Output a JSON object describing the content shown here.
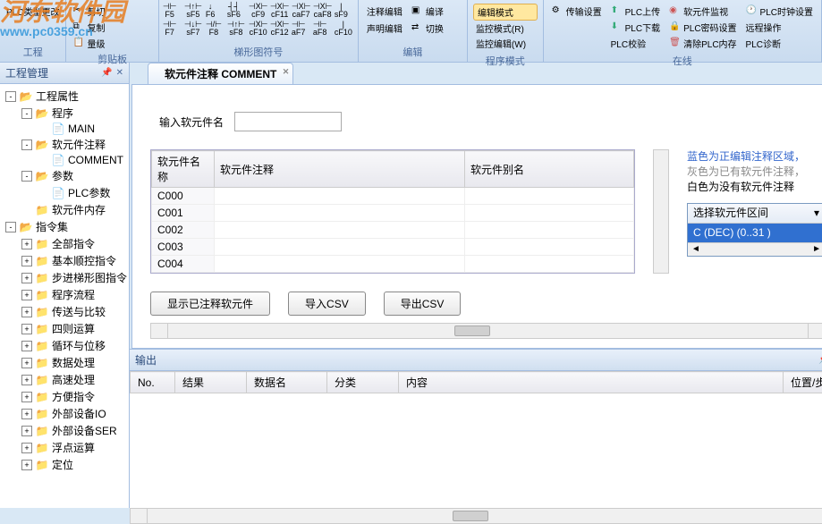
{
  "watermark": {
    "main": "河东软件园",
    "sub": "www.pc0359.cn"
  },
  "ribbon": {
    "groups": {
      "project": {
        "label": "工程",
        "btnType": "PLC类型更改"
      },
      "clipboard": {
        "label": "剪贴板",
        "cut": "剪切",
        "copy": "复制",
        "paste": "量级"
      },
      "ladder": {
        "label": "梯形图符号",
        "cells": [
          [
            "⊣⊢\nF5",
            "⊣↑⊢\nsF5",
            "↓\nF6",
            "┤┤\nsF6",
            "⊣X⊢\ncF9",
            "⊣X⊢\ncF11",
            "⊣X⊢\ncaF7",
            "⊣X⊢\ncaF8",
            "|\nsF9"
          ],
          [
            "⊣⊢\nF7",
            "⊣↓⊢\nsF7",
            "⊣/⊢\nF8",
            "⊣↑⊢\nsF8",
            "⊣X⊢\ncF10",
            "⊣X⊢\ncF12",
            "⊣⊢\naF7",
            "⊣⊢\naF8",
            "|\ncF10"
          ]
        ]
      },
      "edit": {
        "label": "编辑",
        "a1": "注释编辑",
        "a2": "声明编辑",
        "b1": "编译",
        "b2": "切换"
      },
      "program": {
        "label": "程序",
        "a": "编辑模式",
        "b": "监控模式(R)",
        "c": "监控编辑(W)",
        "d": "程序模式"
      },
      "online": {
        "label": "在线",
        "a": "传输设置",
        "b": "PLC上传",
        "c": "PLC下载",
        "d": "PLC校验",
        "e": "软元件监视",
        "f": "PLC密码设置",
        "g": "清除PLC内存",
        "h": "PLC时钟设置",
        "i": "远程操作",
        "j": "PLC诊断"
      }
    }
  },
  "sidebar": {
    "title": "工程管理",
    "tree": [
      {
        "lvl": 0,
        "exp": "-",
        "ico": "fo",
        "label": "工程属性"
      },
      {
        "lvl": 1,
        "exp": "-",
        "ico": "fo",
        "label": "程序"
      },
      {
        "lvl": 2,
        "exp": "",
        "ico": "fi",
        "label": "MAIN"
      },
      {
        "lvl": 1,
        "exp": "-",
        "ico": "fo",
        "label": "软元件注释"
      },
      {
        "lvl": 2,
        "exp": "",
        "ico": "fi",
        "label": "COMMENT"
      },
      {
        "lvl": 1,
        "exp": "-",
        "ico": "fo",
        "label": "参数"
      },
      {
        "lvl": 2,
        "exp": "",
        "ico": "fi",
        "label": "PLC参数"
      },
      {
        "lvl": 1,
        "exp": "",
        "ico": "fc",
        "label": "软元件内存"
      },
      {
        "lvl": 0,
        "exp": "-",
        "ico": "fo",
        "label": "指令集"
      },
      {
        "lvl": 1,
        "exp": "+",
        "ico": "fc",
        "label": "全部指令"
      },
      {
        "lvl": 1,
        "exp": "+",
        "ico": "fc",
        "label": "基本顺控指令"
      },
      {
        "lvl": 1,
        "exp": "+",
        "ico": "fc",
        "label": "步进梯形图指令"
      },
      {
        "lvl": 1,
        "exp": "+",
        "ico": "fc",
        "label": "程序流程"
      },
      {
        "lvl": 1,
        "exp": "+",
        "ico": "fc",
        "label": "传送与比较"
      },
      {
        "lvl": 1,
        "exp": "+",
        "ico": "fc",
        "label": "四则运算"
      },
      {
        "lvl": 1,
        "exp": "+",
        "ico": "fc",
        "label": "循环与位移"
      },
      {
        "lvl": 1,
        "exp": "+",
        "ico": "fc",
        "label": "数据处理"
      },
      {
        "lvl": 1,
        "exp": "+",
        "ico": "fc",
        "label": "高速处理"
      },
      {
        "lvl": 1,
        "exp": "+",
        "ico": "fc",
        "label": "方便指令"
      },
      {
        "lvl": 1,
        "exp": "+",
        "ico": "fc",
        "label": "外部设备IO"
      },
      {
        "lvl": 1,
        "exp": "+",
        "ico": "fc",
        "label": "外部设备SER"
      },
      {
        "lvl": 1,
        "exp": "+",
        "ico": "fc",
        "label": "浮点运算"
      },
      {
        "lvl": 1,
        "exp": "+",
        "ico": "fc",
        "label": "定位"
      }
    ]
  },
  "tab": {
    "title": "软元件注释 COMMENT"
  },
  "doc": {
    "inputLabel": "输入软元件名",
    "inputValue": "",
    "grid": {
      "headers": [
        "软元件名称",
        "软元件注释",
        "软元件别名"
      ],
      "rows": [
        "C000",
        "C001",
        "C002",
        "C003",
        "C004"
      ]
    },
    "info": {
      "l1": "蓝色为正编辑注释区域，",
      "l2": "灰色为已有软元件注释，",
      "l3": "白色为没有软元件注释"
    },
    "dropdown": {
      "head": "选择软元件区间",
      "item": "C (DEC)  (0..31  )"
    },
    "buttons": {
      "a": "显示已注释软元件",
      "b": "导入CSV",
      "c": "导出CSV"
    }
  },
  "output": {
    "title": "输出",
    "headers": [
      "No.",
      "结果",
      "数据名",
      "分类",
      "内容",
      "位置/步"
    ]
  }
}
